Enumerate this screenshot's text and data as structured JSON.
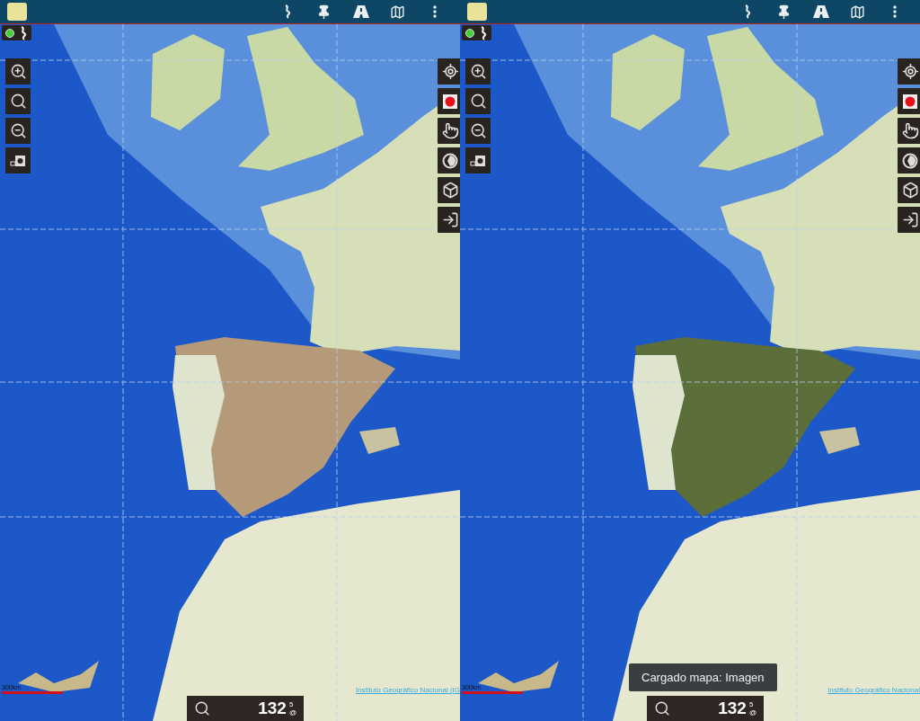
{
  "panels": [
    {
      "kind": "roads",
      "scale_label": "300km",
      "attribution": "Instituto Geográfico Nacional (IG",
      "zoom_value": "132",
      "zoom_sup": "5",
      "zoom_sub": "@"
    },
    {
      "kind": "imagery",
      "scale_label": "300km",
      "attribution": "Instituto Geográfico Nacional",
      "zoom_value": "132",
      "zoom_sup": "5",
      "zoom_sub": "@",
      "toast": "Cargado mapa: Imagen"
    }
  ]
}
